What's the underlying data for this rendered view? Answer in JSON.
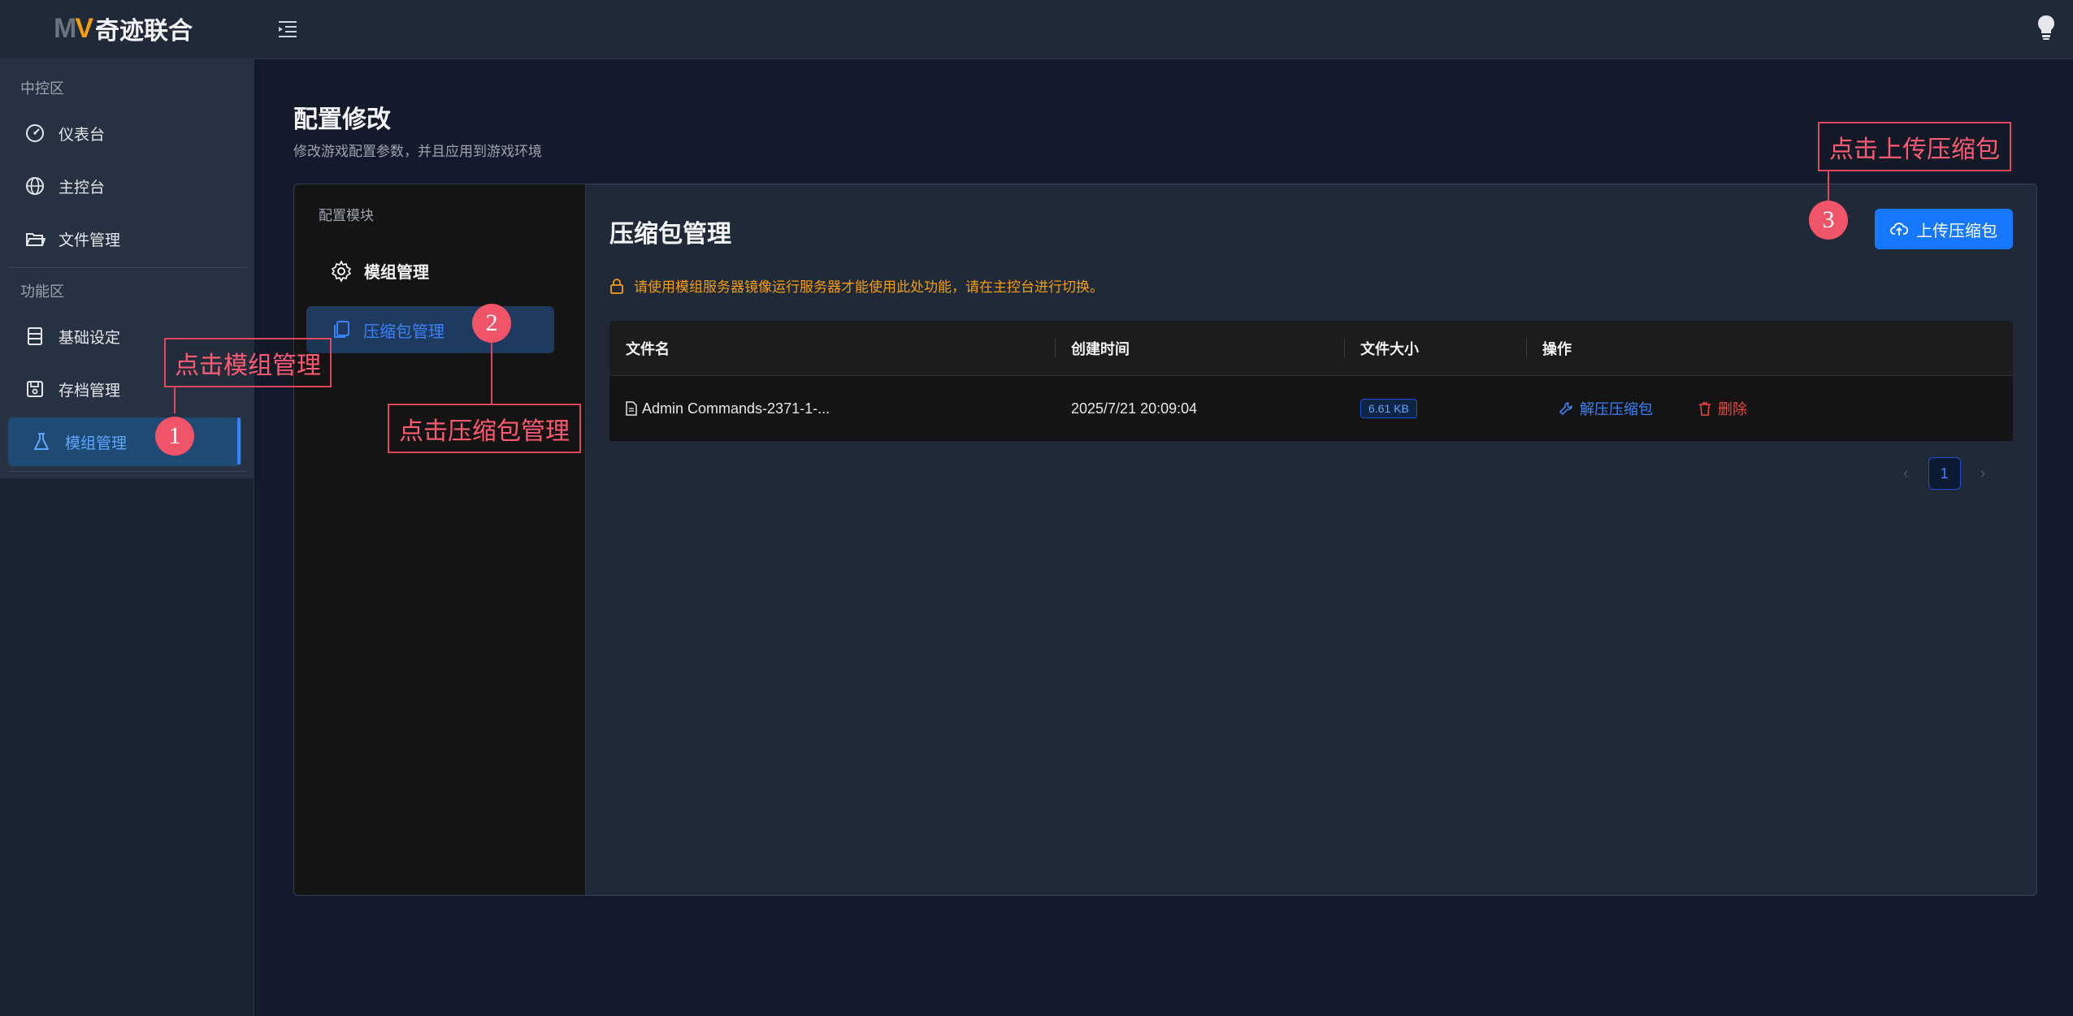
{
  "app": {
    "logo_mark_m": "M",
    "logo_mark_v": "V",
    "logo_text": "奇迹联合"
  },
  "sidebar": {
    "group1": "中控区",
    "items1": [
      {
        "label": "仪表台",
        "icon": "dashboard-icon"
      },
      {
        "label": "主控台",
        "icon": "globe-icon"
      },
      {
        "label": "文件管理",
        "icon": "folder-icon"
      }
    ],
    "group2": "功能区",
    "items2": [
      {
        "label": "基础设定",
        "icon": "server-icon"
      },
      {
        "label": "存档管理",
        "icon": "save-icon"
      },
      {
        "label": "模组管理",
        "icon": "flask-icon"
      }
    ]
  },
  "page": {
    "title": "配置修改",
    "subtitle": "修改游戏配置参数，并且应用到游戏环境"
  },
  "config": {
    "module_title": "配置模块",
    "mod_manage": "模组管理",
    "zip_manage": "压缩包管理"
  },
  "zip": {
    "title": "压缩包管理",
    "upload_label": "上传压缩包",
    "warning": "请使用模组服务器镜像运行服务器才能使用此处功能，请在主控台进行切换。",
    "columns": [
      "文件名",
      "创建时间",
      "文件大小",
      "操作"
    ],
    "rows": [
      {
        "filename": "Admin Commands-2371-1-...",
        "created": "2025/7/21 20:09:04",
        "size": "6.61 KB",
        "extract": "解压压缩包",
        "delete": "删除"
      }
    ],
    "page": "1"
  },
  "annotations": {
    "a1_text": "点击模组管理",
    "a1_num": "1",
    "a2_text": "点击压缩包管理",
    "a2_num": "2",
    "a3_text": "点击上传压缩包",
    "a3_num": "3"
  },
  "colors": {
    "accent": "#1677ff",
    "warning": "#f59e0b",
    "danger": "#ef4444",
    "annotation": "#e0475e"
  }
}
